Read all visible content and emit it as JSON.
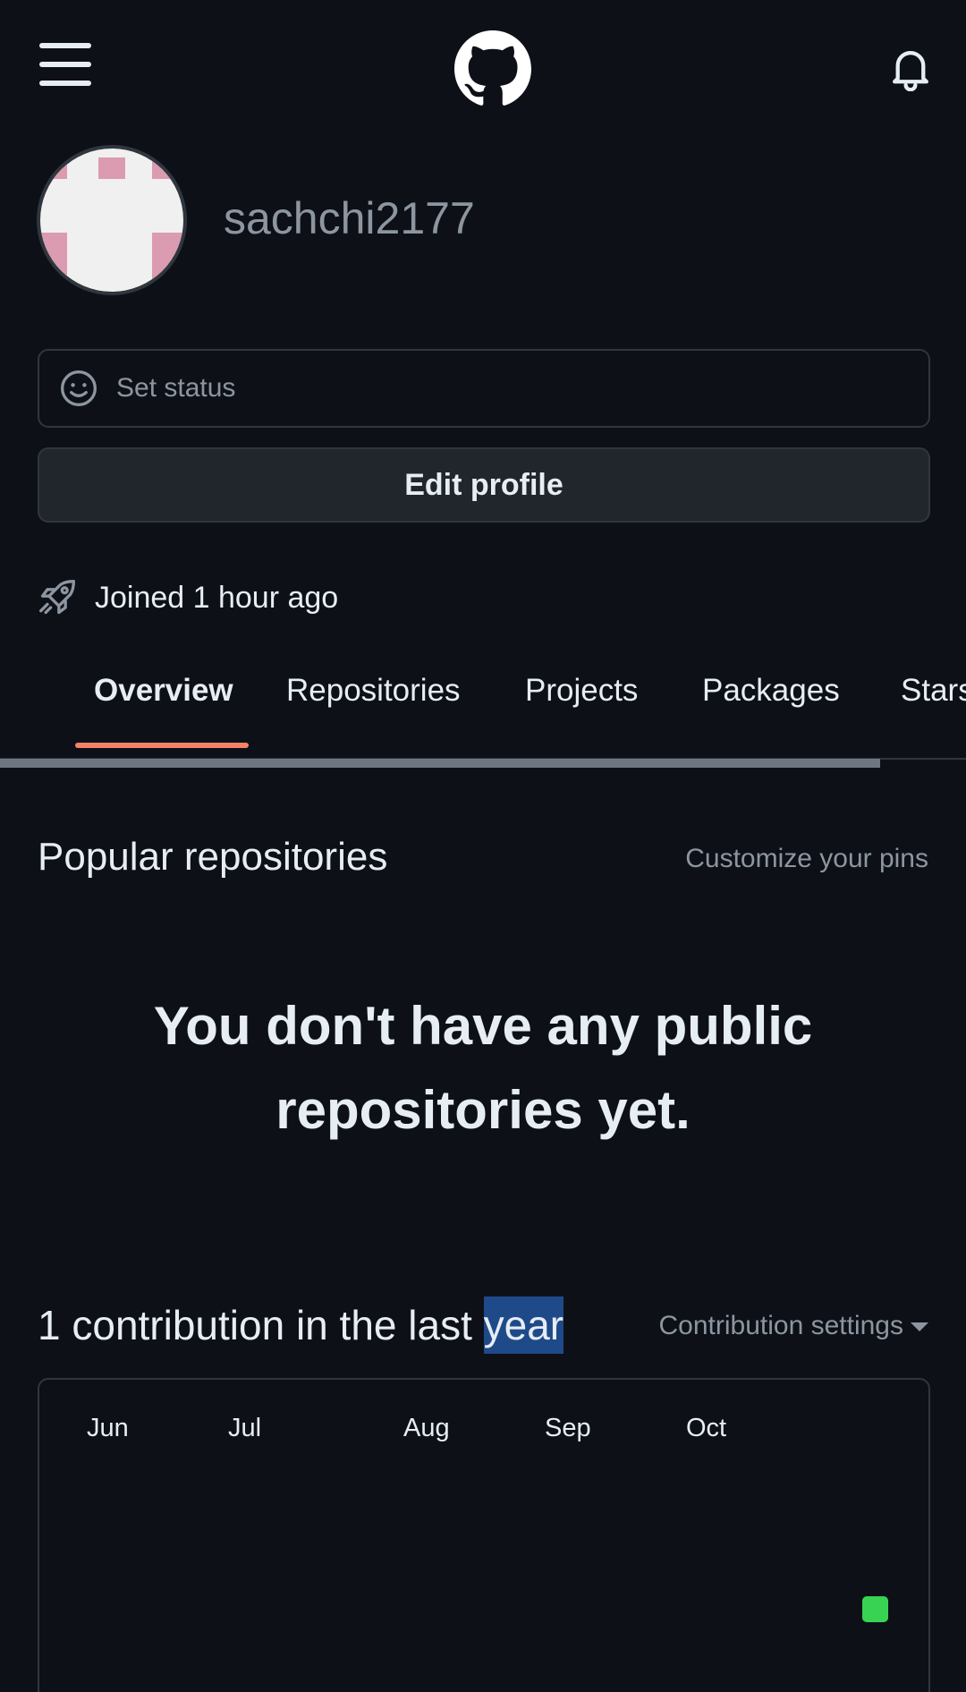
{
  "profile": {
    "username": "sachchi2177",
    "status_label": "Set status",
    "edit_label": "Edit profile",
    "joined": "Joined 1 hour ago"
  },
  "tabs": [
    {
      "label": "Overview",
      "active": true
    },
    {
      "label": "Repositories"
    },
    {
      "label": "Projects"
    },
    {
      "label": "Packages"
    },
    {
      "label": "Stars"
    }
  ],
  "popular": {
    "title": "Popular repositories",
    "customize": "Customize your pins",
    "empty_line1": "You don't have any public",
    "empty_line2": "repositories yet."
  },
  "contributions": {
    "title_prefix": "1 contribution in the last ",
    "title_highlight": "year",
    "settings_label": "Contribution settings",
    "months": [
      "Jun",
      "Jul",
      "Aug",
      "Sep",
      "Oct"
    ],
    "cell_color": "#39d353"
  },
  "colors": {
    "background": "#0d1117",
    "tab_underline": "#f78166",
    "avatar_pink": "#db9bb0",
    "selection": "#1f4a8a"
  },
  "icons": [
    "hamburger-menu-icon",
    "github-logo-icon",
    "bell-icon",
    "smiley-icon",
    "rocket-icon",
    "caret-down-icon"
  ]
}
